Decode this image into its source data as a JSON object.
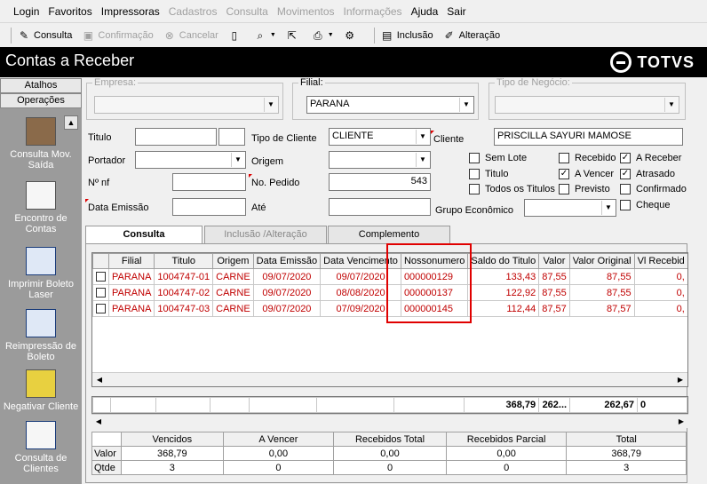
{
  "menu": {
    "items": [
      {
        "label": "Login",
        "enabled": true
      },
      {
        "label": "Favoritos",
        "enabled": true
      },
      {
        "label": "Impressoras",
        "enabled": true
      },
      {
        "label": "Cadastros",
        "enabled": false
      },
      {
        "label": "Consulta",
        "enabled": false
      },
      {
        "label": "Movimentos",
        "enabled": false
      },
      {
        "label": "Informações",
        "enabled": false
      },
      {
        "label": "Ajuda",
        "enabled": true
      },
      {
        "label": "Sair",
        "enabled": true
      }
    ]
  },
  "toolbar": {
    "consulta": "Consulta",
    "confirmacao": "Confirmação",
    "cancelar": "Cancelar",
    "inclusao": "Inclusão",
    "alteracao": "Alteração"
  },
  "window": {
    "title": "Contas a Receber",
    "logo": "TOTVS"
  },
  "sidebar": {
    "atalhos": "Atalhos",
    "operacoes": "Operações",
    "items": [
      {
        "label": "Consulta Mov. Saída",
        "icon": "register-icon"
      },
      {
        "label": "Encontro de Contas",
        "icon": "documents-icon"
      },
      {
        "label": "Imprimir Boleto Laser",
        "icon": "print-window-icon"
      },
      {
        "label": "Reimpressão de Boleto",
        "icon": "reprint-window-icon"
      },
      {
        "label": "Negativar Cliente",
        "icon": "negative-client-icon"
      },
      {
        "label": "Consulta de Clientes",
        "icon": "client-card-icon"
      }
    ]
  },
  "filters": {
    "empresa_label": "Empresa:",
    "empresa_value": "",
    "filial_label": "Filial:",
    "filial_value": "PARANA",
    "tipo_negocio_label": "Tipo de Negócio:",
    "tipo_negocio_value": "",
    "titulo_label": "Titulo",
    "tipo_cliente_label": "Tipo de Cliente",
    "tipo_cliente_value": "CLIENTE",
    "cliente_label": "Cliente",
    "cliente_value": "PRISCILLA SAYURI MAMOSE",
    "portador_label": "Portador",
    "origem_label": "Origem",
    "nnf_label": "Nº nf",
    "pedido_label": "No. Pedido",
    "pedido_value": "543",
    "data_emissao_label": "Data Emissão",
    "ate_label": "Até",
    "grupo_label": "Grupo Econômico"
  },
  "checkboxes": [
    {
      "label": "Sem Lote",
      "checked": false
    },
    {
      "label": "Titulo",
      "checked": false
    },
    {
      "label": "Todos os Titulos",
      "checked": false
    },
    {
      "label": "Recebido",
      "checked": false
    },
    {
      "label": "A Vencer",
      "checked": true
    },
    {
      "label": "Previsto",
      "checked": false
    },
    {
      "label": "A Receber",
      "checked": true
    },
    {
      "label": "Atrasado",
      "checked": true
    },
    {
      "label": "Confirmado",
      "checked": false
    },
    {
      "label": "Cheque",
      "checked": false
    }
  ],
  "tabs": [
    "Consulta",
    "Inclusão /Alteração",
    "Complemento"
  ],
  "grid": {
    "columns": [
      "",
      "Filial",
      "Titulo",
      "Origem",
      "Data Emissão",
      "Data Vencimento",
      "Nossonumero",
      "Saldo do Titulo",
      "Valor",
      "Valor Original",
      "Vl Recebid"
    ],
    "rows": [
      [
        "PARANA",
        "1004747-01",
        "CARNE",
        "09/07/2020",
        "09/07/2020",
        "000000129",
        "133,43",
        "87,55",
        "87,55",
        "0,"
      ],
      [
        "PARANA",
        "1004747-02",
        "CARNE",
        "09/07/2020",
        "08/08/2020",
        "000000137",
        "122,92",
        "87,55",
        "87,55",
        "0,"
      ],
      [
        "PARANA",
        "1004747-03",
        "CARNE",
        "09/07/2020",
        "07/09/2020",
        "000000145",
        "112,44",
        "87,57",
        "87,57",
        "0,"
      ]
    ]
  },
  "totals": {
    "saldo": "368,79",
    "valor": "262...",
    "valor_original": "262,67",
    "vl_recebido": "0"
  },
  "summary": {
    "headers": [
      "Vencidos",
      "A Vencer",
      "Recebidos Total",
      "Recebidos Parcial",
      "Total"
    ],
    "rows": [
      {
        "label": "Valor",
        "values": [
          "368,79",
          "0,00",
          "0,00",
          "0,00",
          "368,79"
        ]
      },
      {
        "label": "Qtde",
        "values": [
          "3",
          "0",
          "0",
          "0",
          "3"
        ]
      }
    ]
  },
  "colors": {
    "row_text": "#c00000",
    "highlight": "#e00000",
    "sidebar": "#9b9b9b",
    "title_bg": "#000000"
  }
}
